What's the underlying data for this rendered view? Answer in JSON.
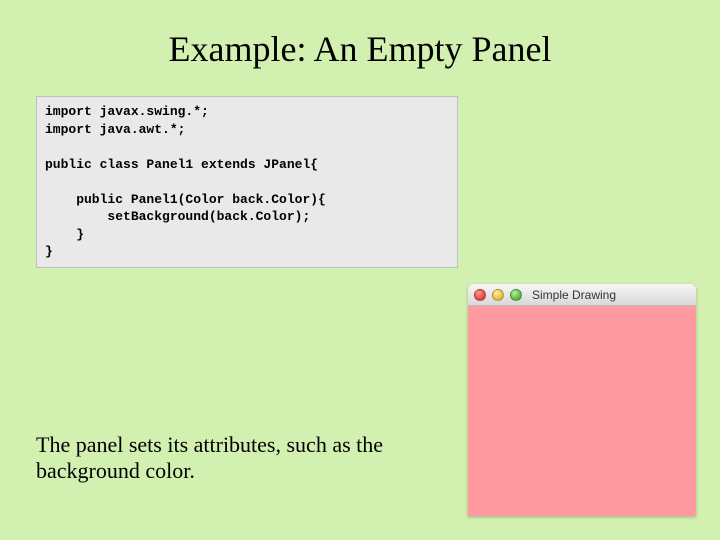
{
  "title": "Example: An Empty Panel",
  "code": "import javax.swing.*;\nimport java.awt.*;\n\npublic class Panel1 extends JPanel{\n\n    public Panel1(Color back.Color){\n        setBackground(back.Color);\n    }\n}",
  "caption": "The panel sets its attributes, such as the background color.",
  "window": {
    "title": "Simple Drawing"
  }
}
